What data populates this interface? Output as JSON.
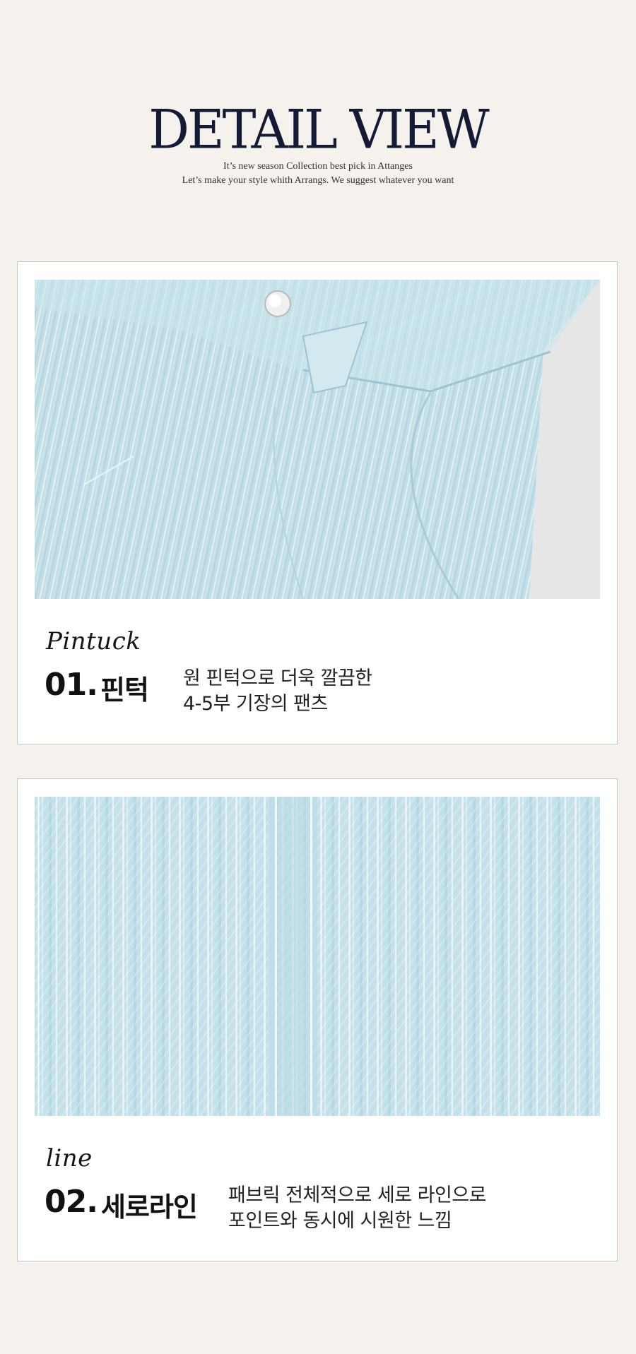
{
  "header": {
    "title": "DETAIL VIEW",
    "subtitle_line1": "It’s new season Collection best pick in Attanges",
    "subtitle_line2": "Let’s make your style whith Arrangs. We suggest whatever you want"
  },
  "details": [
    {
      "script_label": "Pintuck",
      "number": "01.",
      "name": "핀턱",
      "description_line1": "원 핀턱으로 더욱 깔끔한",
      "description_line2": "4-5부 기장의 팬츠",
      "photo_icon": "light-blue-denim-waistband-photo"
    },
    {
      "script_label": "line",
      "number": "02.",
      "name": "세로라인",
      "description_line1": "패브릭 전체적으로 세로 라인으로",
      "description_line2": "포인트와 동시에 시원한 느낌",
      "photo_icon": "vertical-stripe-fabric-photo"
    }
  ],
  "colors": {
    "background": "#f5f2ed",
    "card": "#ffffff",
    "title": "#141a33",
    "fabric": "#c3e0e8"
  }
}
